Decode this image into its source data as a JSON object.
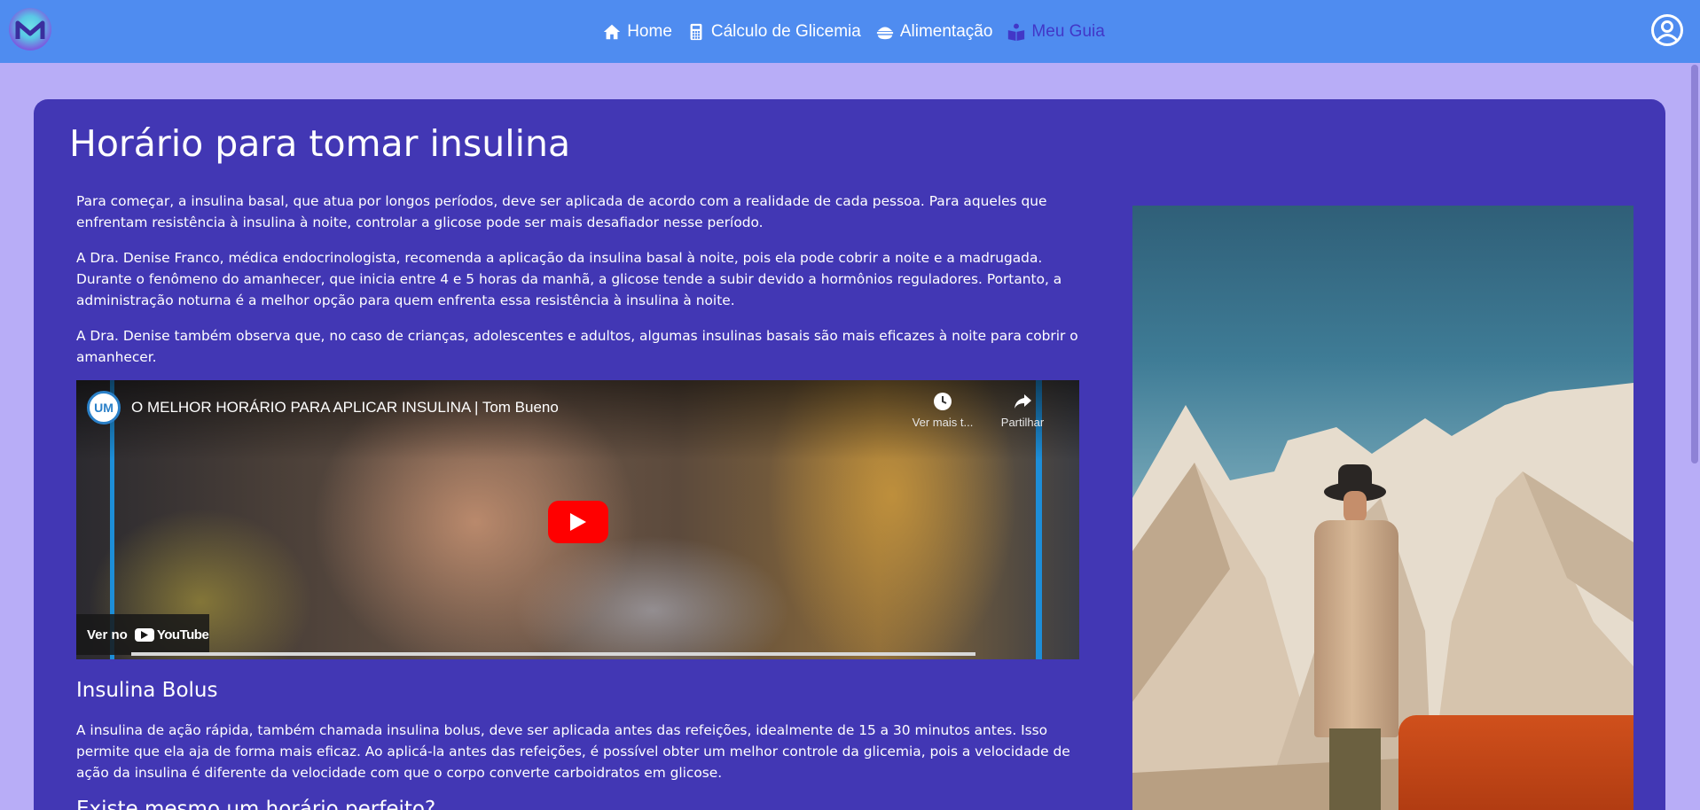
{
  "nav": {
    "links": [
      {
        "label": "Home",
        "icon": "home-icon"
      },
      {
        "label": "Cálculo de Glicemia",
        "icon": "calculator-icon"
      },
      {
        "label": "Alimentação",
        "icon": "food-bowl-icon"
      },
      {
        "label": "Meu Guia",
        "icon": "reading-person-icon",
        "active": true
      }
    ],
    "profile_icon": "user-circle-icon"
  },
  "page": {
    "title": "Horário para tomar insulina",
    "paragraphs": [
      "Para começar, a insulina basal, que atua por longos períodos, deve ser aplicada de acordo com a realidade de cada pessoa. Para aqueles que enfrentam resistência à insulina à noite, controlar a glicose pode ser mais desafiador nesse período.",
      "A Dra. Denise Franco, médica endocrinologista, recomenda a aplicação da insulina basal à noite, pois ela pode cobrir a noite e a madrugada. Durante o fenômeno do amanhecer, que inicia entre 4 e 5 horas da manhã, a glicose tende a subir devido a hormônios reguladores. Portanto, a administração noturna é a melhor opção para quem enfrenta essa resistência à insulina à noite.",
      "A Dra. Denise também observa que, no caso de crianças, adolescentes e adultos, algumas insulinas basais são mais eficazes à noite para cobrir o amanhecer."
    ],
    "video": {
      "channel_badge": "UM",
      "title": "O MELHOR HORÁRIO PARA APLICAR INSULINA | Tom Bueno",
      "watch_later": "Ver mais t...",
      "share": "Partilhar",
      "watch_on": "Ver no",
      "youtube": "YouTube"
    },
    "section_bolus": {
      "title": "Insulina Bolus",
      "paragraph": "A insulina de ação rápida, também chamada insulina bolus, deve ser aplicada antes das refeições, idealmente de 15 a 30 minutos antes. Isso permite que ela aja de forma mais eficaz. Ao aplicá-la antes das refeições, é possível obter um melhor controle da glicemia, pois a velocidade de ação da insulina é diferente da velocidade com que o corpo converte carboidratos em glicose."
    },
    "section_next": {
      "title": "Existe mesmo um horário perfeito?"
    }
  },
  "colors": {
    "navbar": "#4f8cf0",
    "background": "#b8adf7",
    "card": "#4237b4",
    "active_link": "#4237c7",
    "youtube_red": "#ff0000"
  }
}
